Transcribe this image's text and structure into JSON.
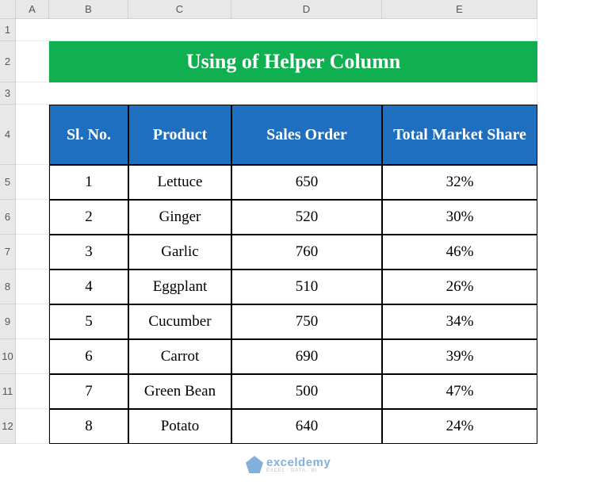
{
  "columns": [
    "A",
    "B",
    "C",
    "D",
    "E"
  ],
  "rows": [
    "1",
    "2",
    "3",
    "4",
    "5",
    "6",
    "7",
    "8",
    "9",
    "10",
    "11",
    "12"
  ],
  "title": "Using of Helper Column",
  "headers": [
    "Sl. No.",
    "Product",
    "Sales Order",
    "Total Market Share"
  ],
  "data": [
    {
      "sl": "1",
      "product": "Lettuce",
      "sales": "650",
      "share": "32%"
    },
    {
      "sl": "2",
      "product": "Ginger",
      "sales": "520",
      "share": "30%"
    },
    {
      "sl": "3",
      "product": "Garlic",
      "sales": "760",
      "share": "46%"
    },
    {
      "sl": "4",
      "product": "Eggplant",
      "sales": "510",
      "share": "26%"
    },
    {
      "sl": "5",
      "product": "Cucumber",
      "sales": "750",
      "share": "34%"
    },
    {
      "sl": "6",
      "product": "Carrot",
      "sales": "690",
      "share": "39%"
    },
    {
      "sl": "7",
      "product": "Green Bean",
      "sales": "500",
      "share": "47%"
    },
    {
      "sl": "8",
      "product": "Potato",
      "sales": "640",
      "share": "24%"
    }
  ],
  "watermark": {
    "main": "exceldemy",
    "sub": "EXCEL · DATA · BI"
  }
}
